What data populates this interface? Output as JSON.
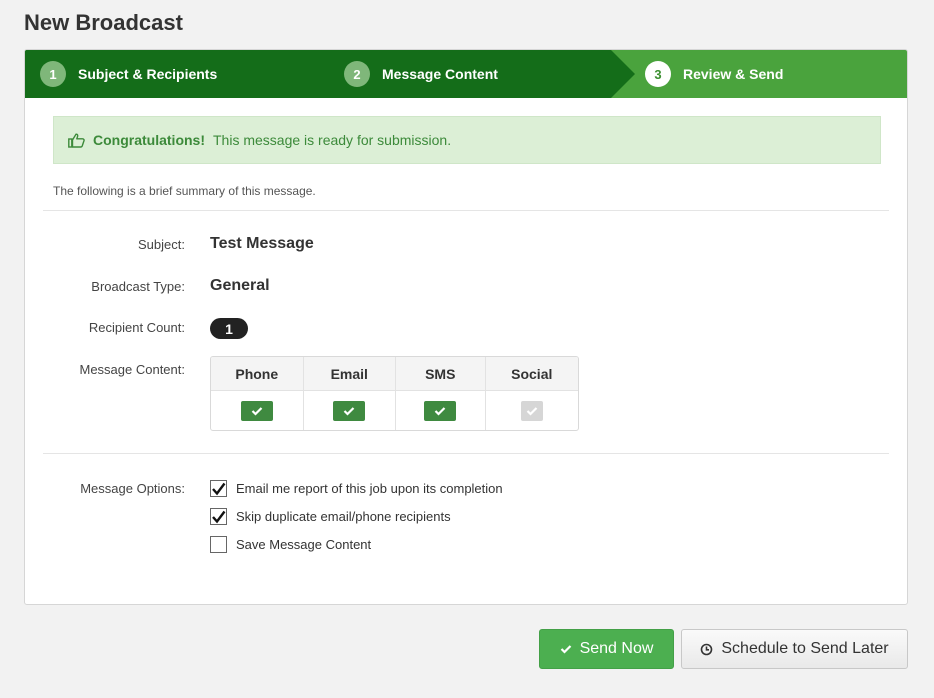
{
  "page": {
    "title": "New Broadcast"
  },
  "steps": [
    {
      "number": "1",
      "label": "Subject & Recipients",
      "state": "complete"
    },
    {
      "number": "2",
      "label": "Message Content",
      "state": "complete"
    },
    {
      "number": "3",
      "label": "Review & Send",
      "state": "active"
    }
  ],
  "alert": {
    "icon": "thumbs-up-icon",
    "strong": "Congratulations!",
    "message": "This message is ready for submission."
  },
  "summary": {
    "intro": "The following is a brief summary of this message.",
    "subject_label": "Subject:",
    "subject_value": "Test Message",
    "type_label": "Broadcast Type:",
    "type_value": "General",
    "count_label": "Recipient Count:",
    "count_value": "1",
    "content_label": "Message Content:",
    "channels": [
      {
        "name": "Phone",
        "enabled": true
      },
      {
        "name": "Email",
        "enabled": true
      },
      {
        "name": "SMS",
        "enabled": true
      },
      {
        "name": "Social",
        "enabled": false
      }
    ]
  },
  "options": {
    "label": "Message Options:",
    "items": [
      {
        "label": "Email me report of this job upon its completion",
        "checked": true
      },
      {
        "label": "Skip duplicate email/phone recipients",
        "checked": true
      },
      {
        "label": "Save Message Content",
        "checked": false
      }
    ]
  },
  "actions": {
    "send_now": "Send Now",
    "schedule": "Schedule to Send Later"
  },
  "colors": {
    "step_dark": "#146d19",
    "step_light": "#4aa33d",
    "alert_bg": "#dcefd6",
    "check_on": "#3f8a40",
    "send_button": "#4caf50"
  }
}
